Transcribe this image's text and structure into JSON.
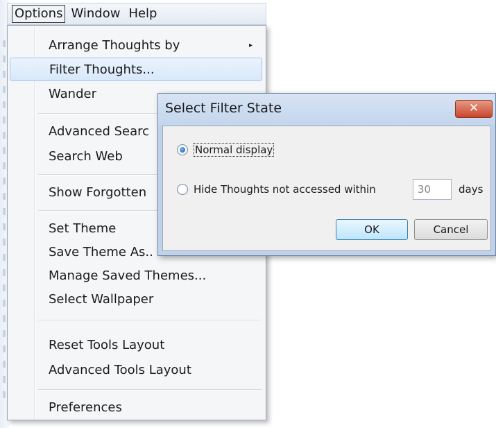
{
  "menubar": {
    "items": [
      "Options",
      "Window",
      "Help"
    ]
  },
  "menu": {
    "items": [
      "Arrange Thoughts by",
      "Filter Thoughts...",
      "Wander",
      "Advanced Searc",
      "Search Web",
      "Show Forgotten",
      "Set Theme",
      "Save Theme As..",
      "Manage Saved Themes...",
      "Select Wallpaper",
      "Reset Tools Layout",
      "Advanced Tools Layout",
      "Preferences"
    ],
    "submenu_arrow": "▸"
  },
  "dialog": {
    "title": "Select Filter State",
    "close": "✕",
    "option_normal": "Normal display",
    "option_hide": "Hide Thoughts not accessed within",
    "days_value": "30",
    "days_label": "days",
    "ok": "OK",
    "cancel": "Cancel",
    "selected_option": "normal"
  }
}
